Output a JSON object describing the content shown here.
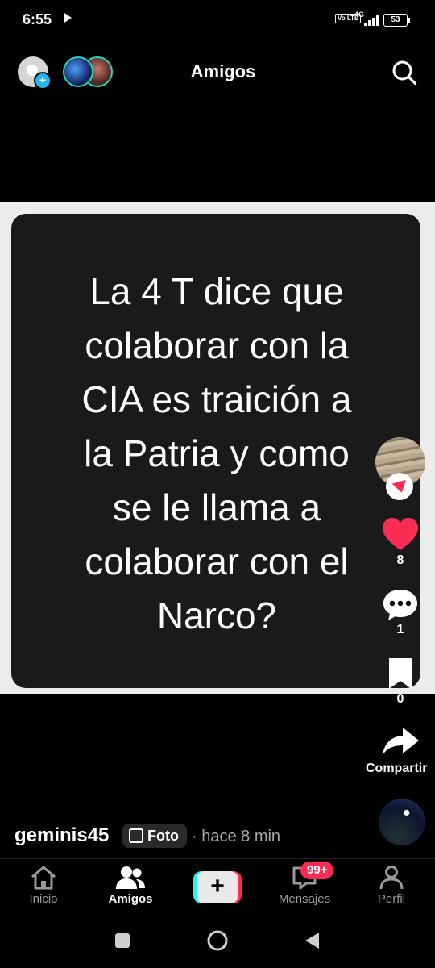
{
  "status_bar": {
    "time": "6:55",
    "volte": "Vo LTE",
    "network": "4G",
    "battery": "53"
  },
  "top_nav": {
    "title": "Amigos",
    "icons": [
      "profile-avatar",
      "add-badge",
      "friends-avatars",
      "search-icon"
    ]
  },
  "post": {
    "image_text_lines": [
      "La 4 T dice que",
      "colaborar con la",
      "CIA es traición a",
      "la Patria y como",
      "se le llama a",
      "colaborar con el",
      "Narco?"
    ],
    "username": "geminis45",
    "type_badge": "Foto",
    "time_ago": "· hace 8 min"
  },
  "actions": {
    "likes": "8",
    "comments": "1",
    "saves": "0",
    "share_label": "Compartir"
  },
  "bottom_nav": {
    "items": [
      {
        "label": "Inicio",
        "icon": "home-icon"
      },
      {
        "label": "Amigos",
        "icon": "friends-icon",
        "active": true
      },
      {
        "label": "",
        "icon": "create-icon"
      },
      {
        "label": "Mensajes",
        "icon": "inbox-icon",
        "badge": "99+"
      },
      {
        "label": "Perfil",
        "icon": "profile-icon"
      }
    ]
  },
  "colors": {
    "accent_red": "#fe2c55",
    "accent_cyan": "#25f4ee",
    "friend_ring": "#2bd3b8"
  }
}
